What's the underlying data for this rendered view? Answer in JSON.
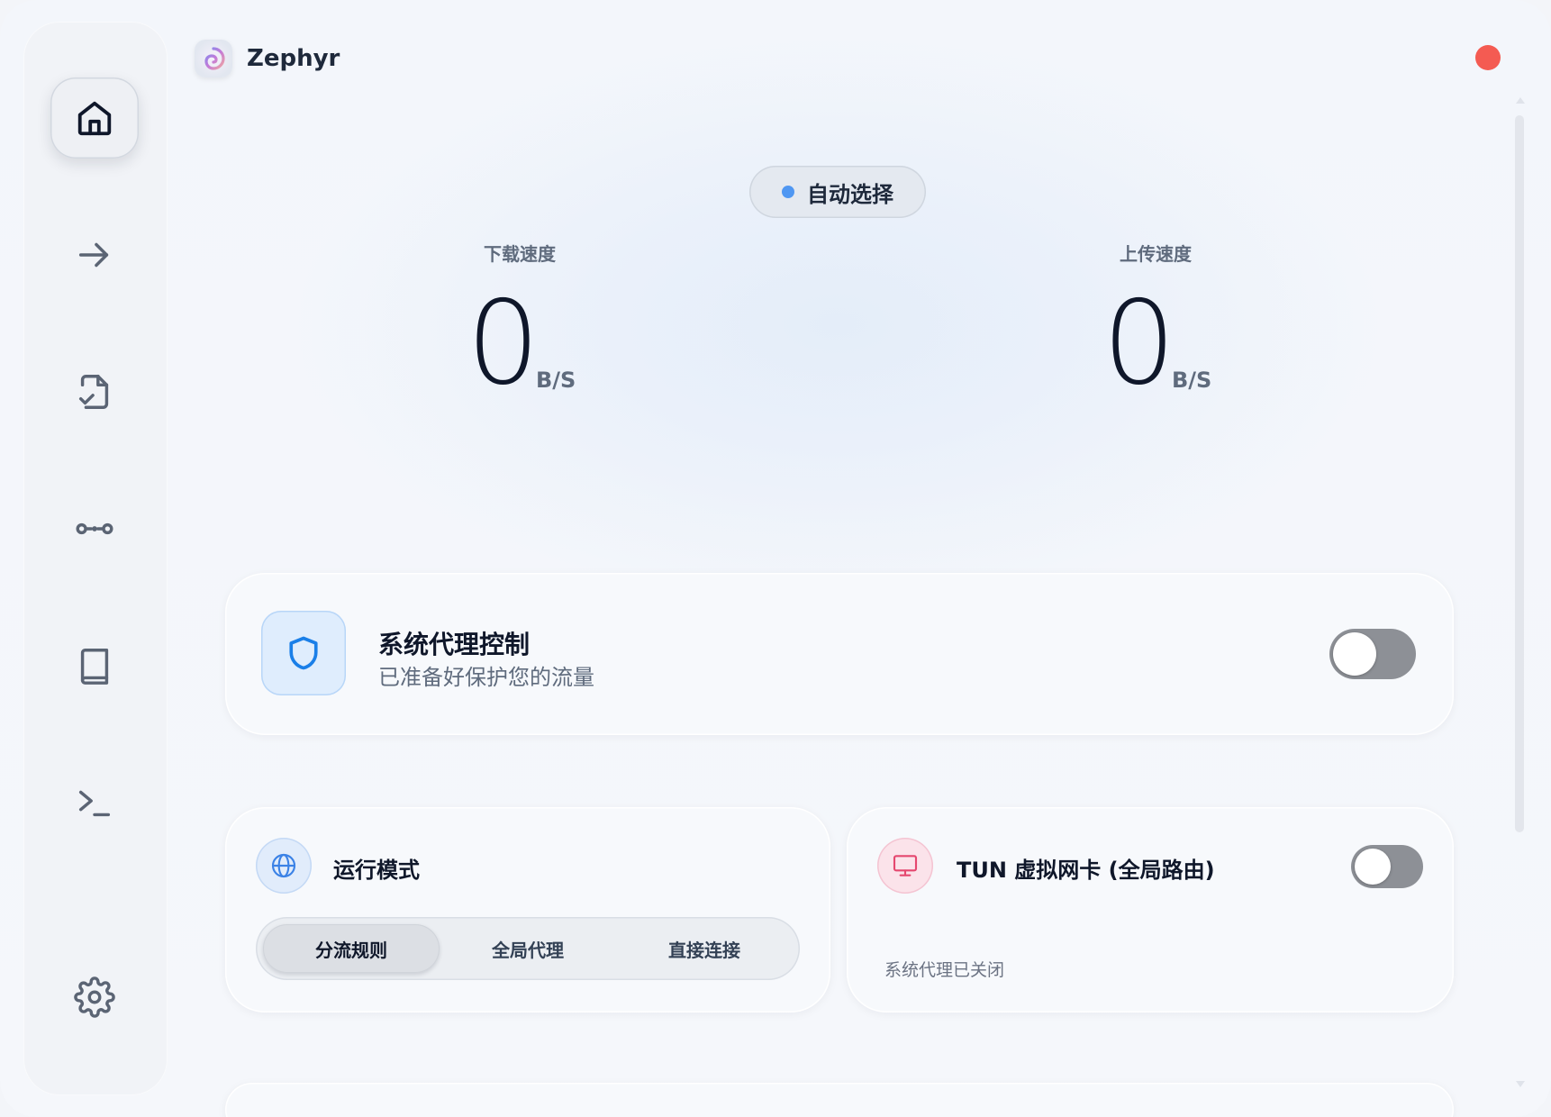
{
  "app": {
    "name": "Zephyr"
  },
  "sidebar": {
    "items": [
      {
        "icon": "home-icon",
        "active": true
      },
      {
        "icon": "arrow-right-icon",
        "active": false
      },
      {
        "icon": "file-check-icon",
        "active": false
      },
      {
        "icon": "connection-icon",
        "active": false
      },
      {
        "icon": "book-icon",
        "active": false
      },
      {
        "icon": "terminal-icon",
        "active": false
      },
      {
        "icon": "gear-icon",
        "active": false
      }
    ]
  },
  "node_selector": {
    "label": "自动选择",
    "dot_color": "#4f97f2"
  },
  "speeds": {
    "download": {
      "title": "下载速度",
      "value": "0",
      "unit": "B/S"
    },
    "upload": {
      "title": "上传速度",
      "value": "0",
      "unit": "B/S"
    }
  },
  "system_proxy": {
    "title": "系统代理控制",
    "subtitle": "已准备好保护您的流量",
    "enabled": false
  },
  "run_mode": {
    "title": "运行模式",
    "options": [
      "分流规则",
      "全局代理",
      "直接连接"
    ],
    "selected": "分流规则"
  },
  "tun": {
    "title": "TUN 虚拟网卡 (全局路由)",
    "enabled": false,
    "status": "系统代理已关闭"
  },
  "colors": {
    "close_dot": "#f45b52",
    "accent_blue": "#4f97f2",
    "shield_blue": "#1a7fe8",
    "monitor_pink": "#e5486f"
  }
}
